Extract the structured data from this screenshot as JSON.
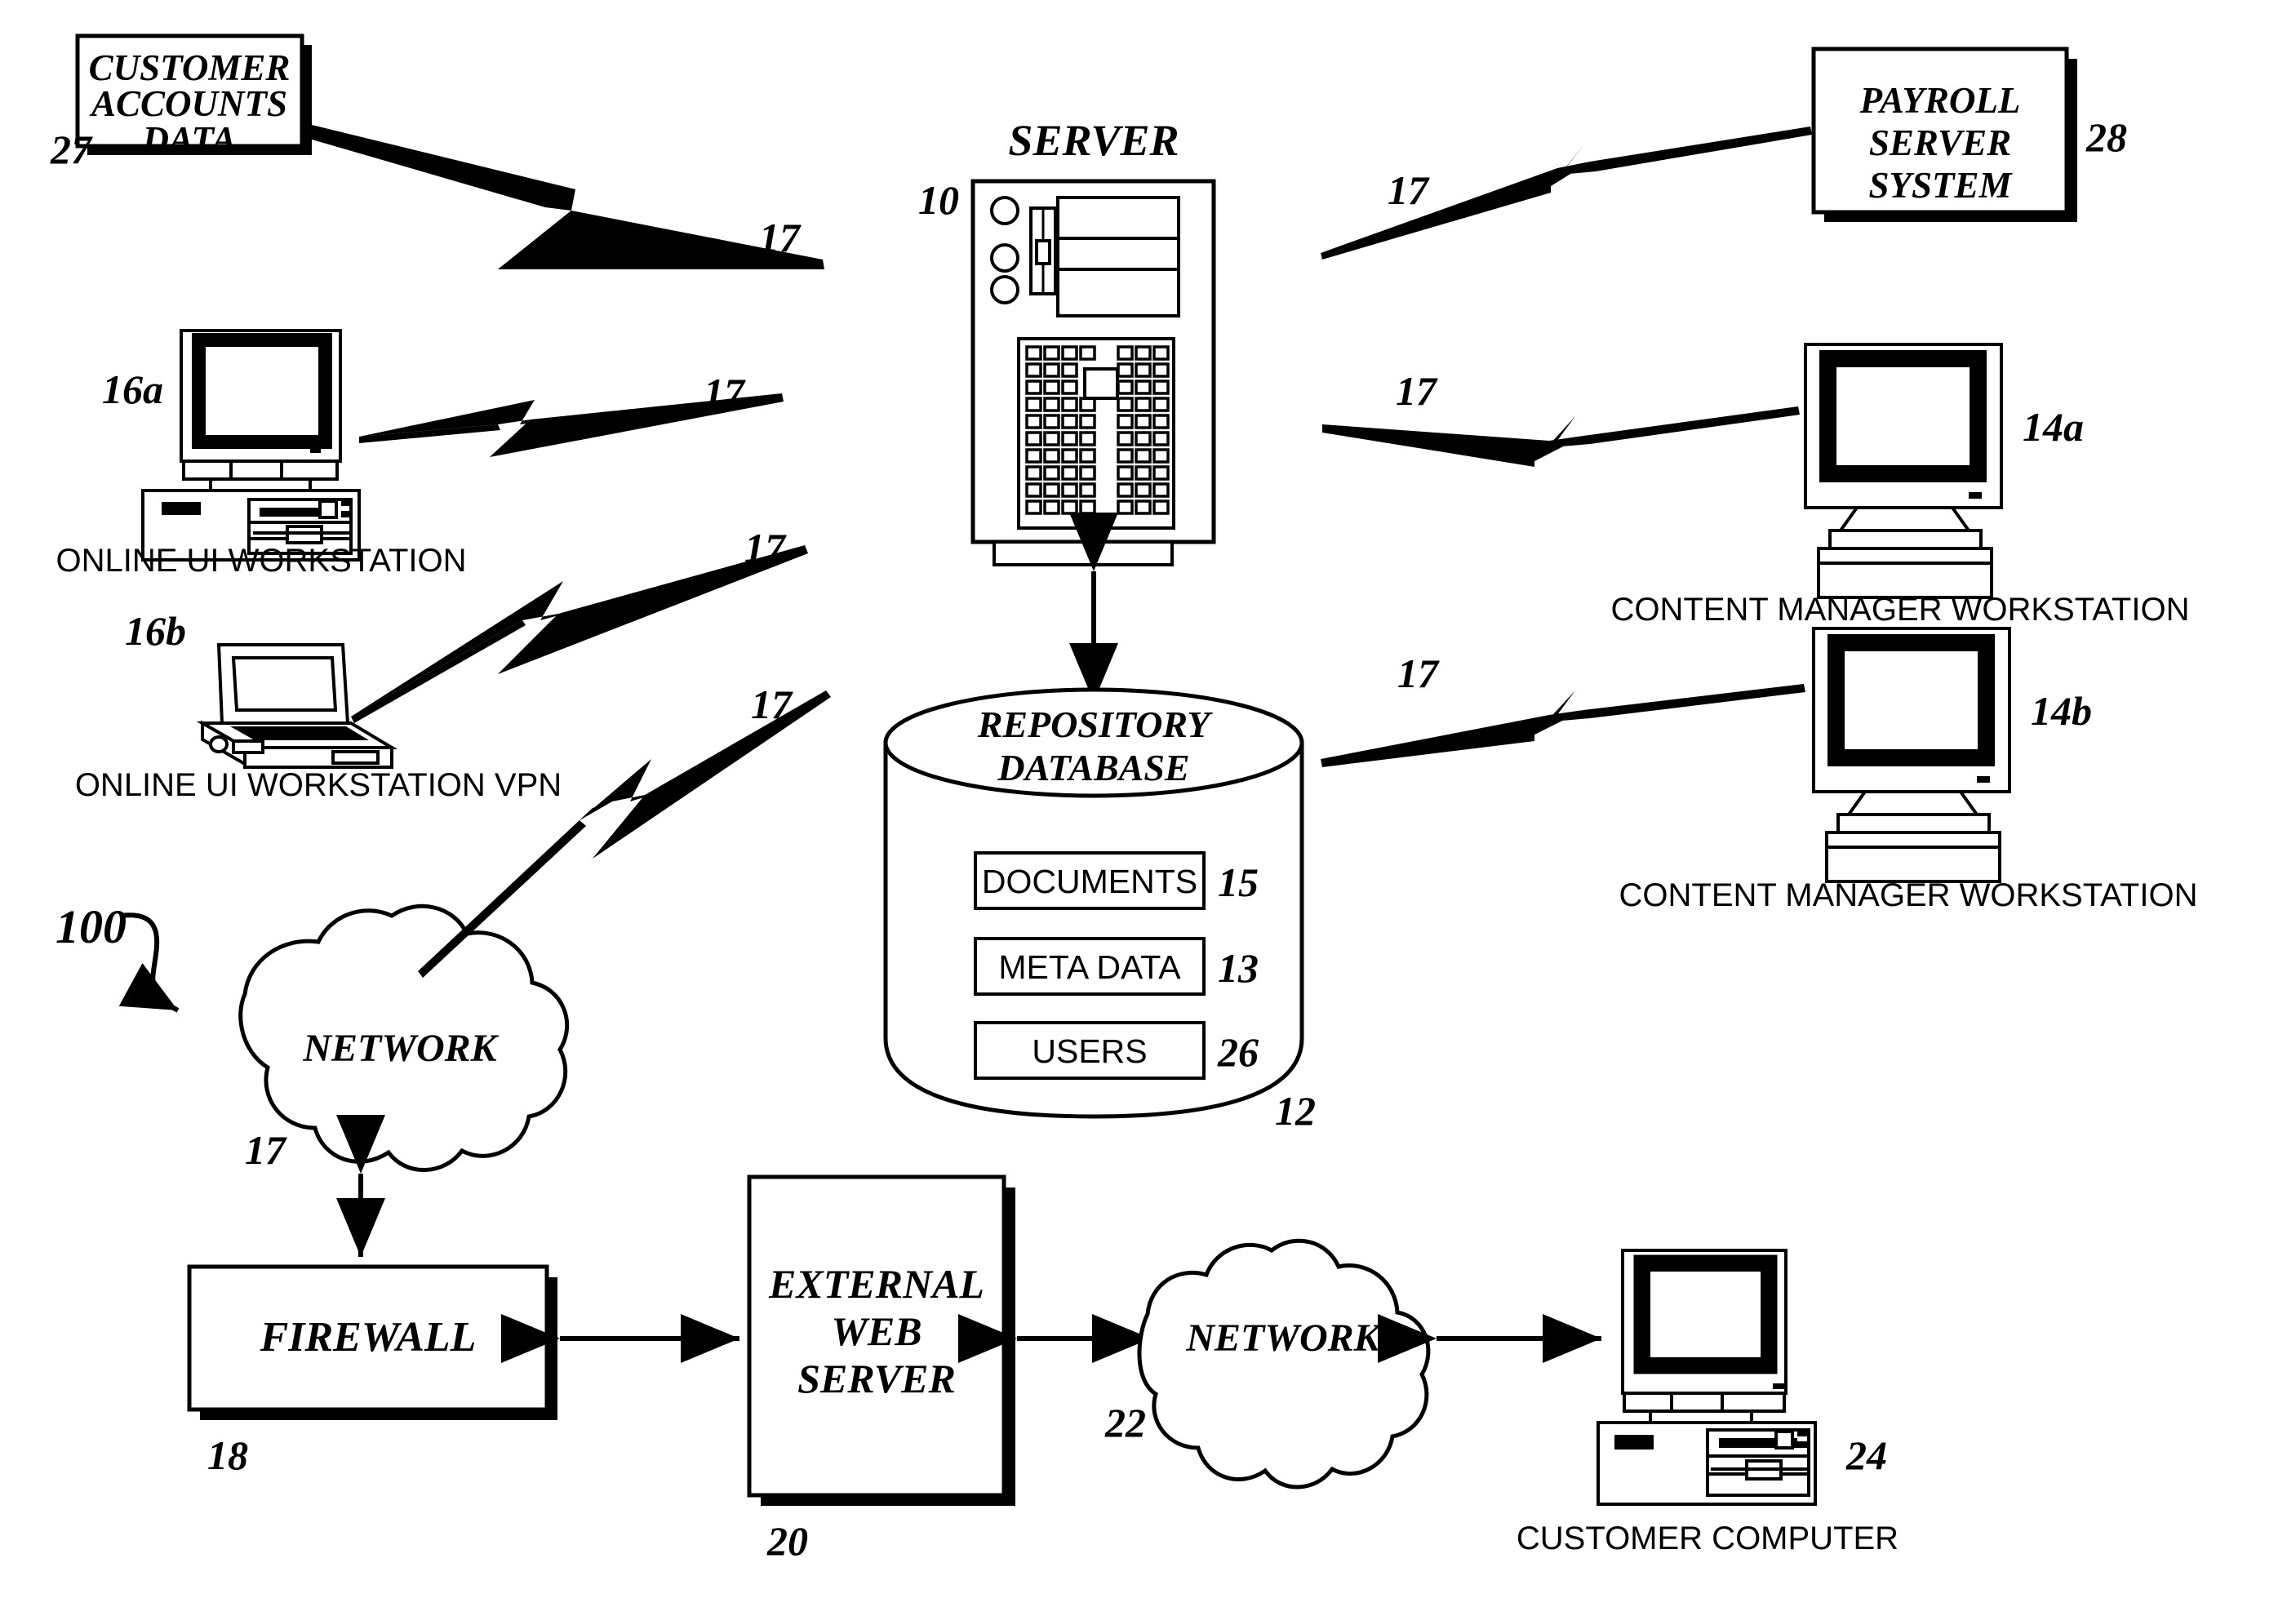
{
  "figure": {
    "type": "patent-network-diagram",
    "system_ref": "100",
    "background": "#ffffff",
    "ink": "#000000"
  },
  "nodes": {
    "customer_accounts_data": {
      "label_lines": [
        "CUSTOMER",
        "ACCOUNTS",
        "DATA"
      ],
      "ref": "27",
      "shape": "box-with-shadow"
    },
    "online_ui_workstation": {
      "caption": "ONLINE UI WORKSTATION",
      "ref": "16a",
      "shape": "desktop-computer"
    },
    "online_ui_workstation_vpn": {
      "caption": "ONLINE UI WORKSTATION VPN",
      "ref": "16b",
      "shape": "laptop-computer"
    },
    "server": {
      "title": "SERVER",
      "ref": "10",
      "shape": "tower-server"
    },
    "payroll_server_system": {
      "label_lines": [
        "PAYROLL",
        "SERVER",
        "SYSTEM"
      ],
      "ref": "28",
      "shape": "box-with-shadow"
    },
    "content_manager_workstation_a": {
      "caption": "CONTENT MANAGER WORKSTATION",
      "ref": "14a",
      "shape": "desktop-monitor-keyboard"
    },
    "content_manager_workstation_b": {
      "caption": "CONTENT MANAGER WORKSTATION",
      "ref": "14b",
      "shape": "desktop-monitor-keyboard"
    },
    "repository_database": {
      "title_lines": [
        "REPOSITORY",
        "DATABASE"
      ],
      "ref": "12",
      "shape": "cylinder",
      "contents": [
        {
          "label": "DOCUMENTS",
          "ref": "15"
        },
        {
          "label": "META DATA",
          "ref": "13"
        },
        {
          "label": "USERS",
          "ref": "26"
        }
      ]
    },
    "network_cloud_top": {
      "label": "NETWORK",
      "ref": "17",
      "shape": "cloud"
    },
    "firewall": {
      "label": "FIREWALL",
      "ref": "18",
      "shape": "box-with-shadow"
    },
    "external_web_server": {
      "label_lines": [
        "EXTERNAL",
        "WEB",
        "SERVER"
      ],
      "ref": "20",
      "shape": "box-with-shadow"
    },
    "network_cloud_bottom": {
      "label": "NETWORK",
      "ref": "22",
      "shape": "cloud"
    },
    "customer_computer": {
      "caption": "CUSTOMER COMPUTER",
      "ref": "24",
      "shape": "desktop-computer"
    }
  },
  "link_refs": {
    "accounts_to_server": "17",
    "workstation16a_to_server": "17",
    "workstation16b_to_server": "17",
    "cloud_to_server": "17",
    "server_to_payroll": "17",
    "server_to_cm14a": "17",
    "server_to_cm14b": "17",
    "cloud_internal": "17"
  },
  "system_label": {
    "ref": "100"
  }
}
